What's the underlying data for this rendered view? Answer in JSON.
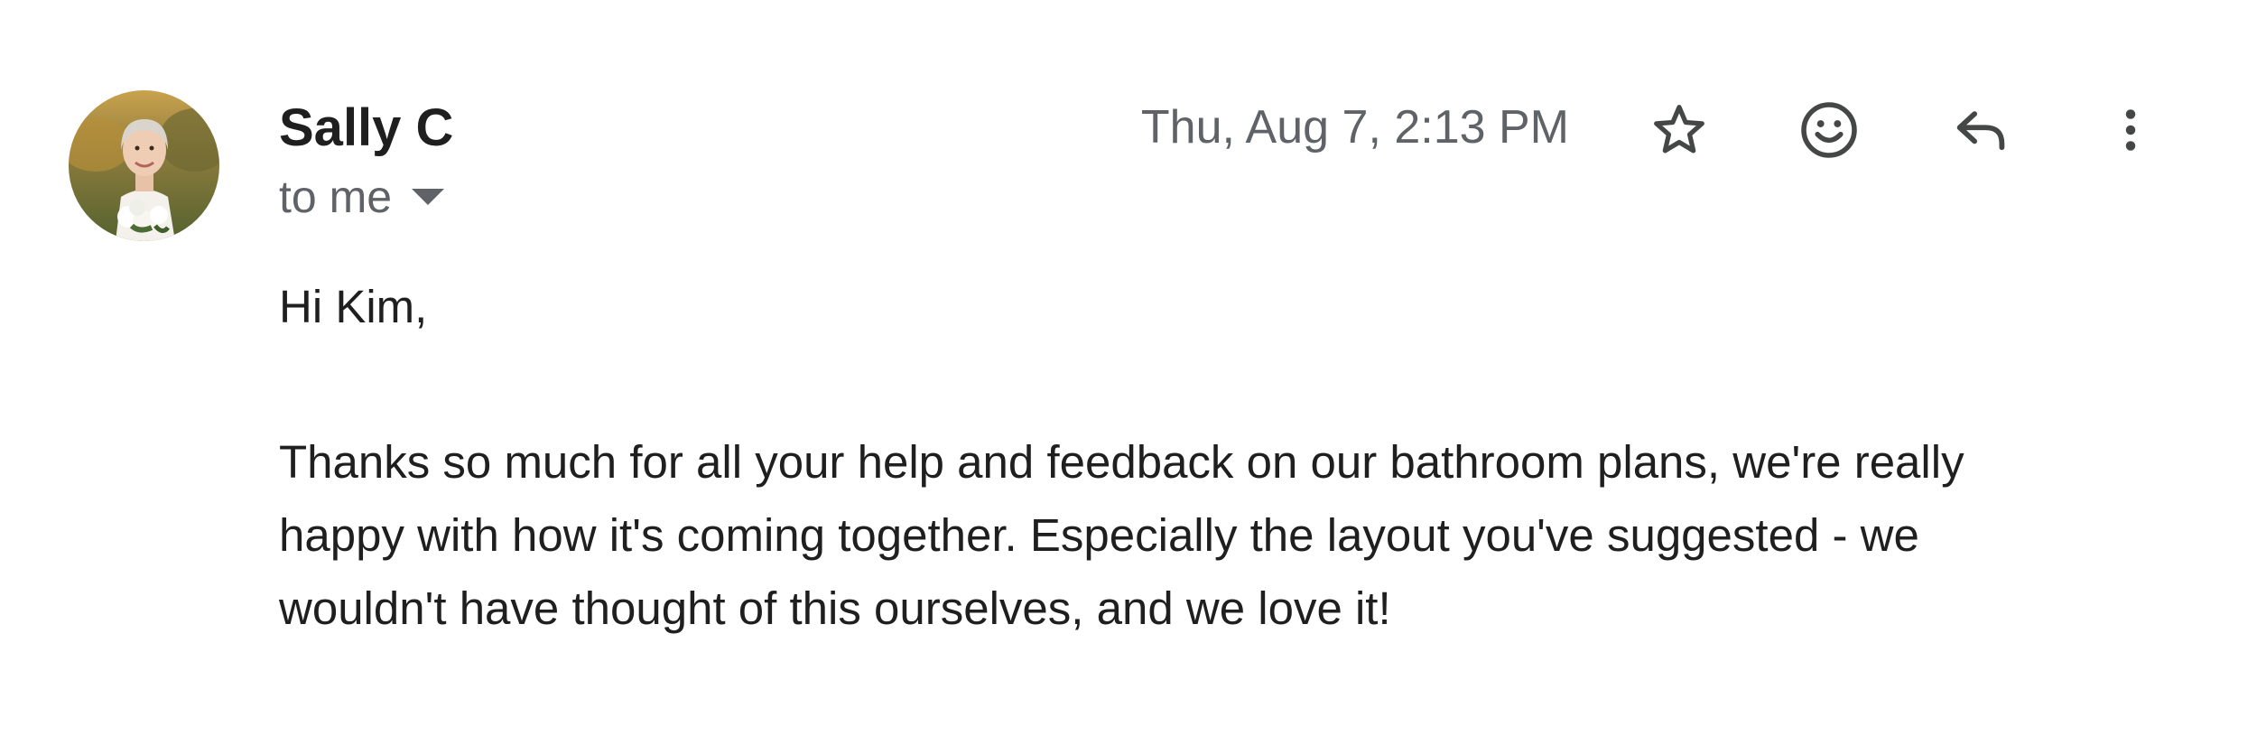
{
  "sender": {
    "name": "Sally C",
    "recipient_label": "to me",
    "avatar_icon": "profile-photo"
  },
  "header": {
    "timestamp": "Thu, Aug 7, 2:13 PM"
  },
  "actions": [
    {
      "icon": "star-icon",
      "label": "Star"
    },
    {
      "icon": "emoji-icon",
      "label": "Add reaction"
    },
    {
      "icon": "reply-icon",
      "label": "Reply"
    },
    {
      "icon": "more-vert-icon",
      "label": "More"
    }
  ],
  "message": {
    "greeting": "Hi Kim,",
    "paragraph": "Thanks so much for all your help and feedback on our bathroom plans, we're really happy with how it's coming together. Especially the layout you've suggested - we wouldn't have thought of this ourselves, and we love it!"
  },
  "colors": {
    "text_primary": "#1f1f1f",
    "text_secondary": "#5f6368",
    "icon": "#444746",
    "background": "#ffffff"
  }
}
